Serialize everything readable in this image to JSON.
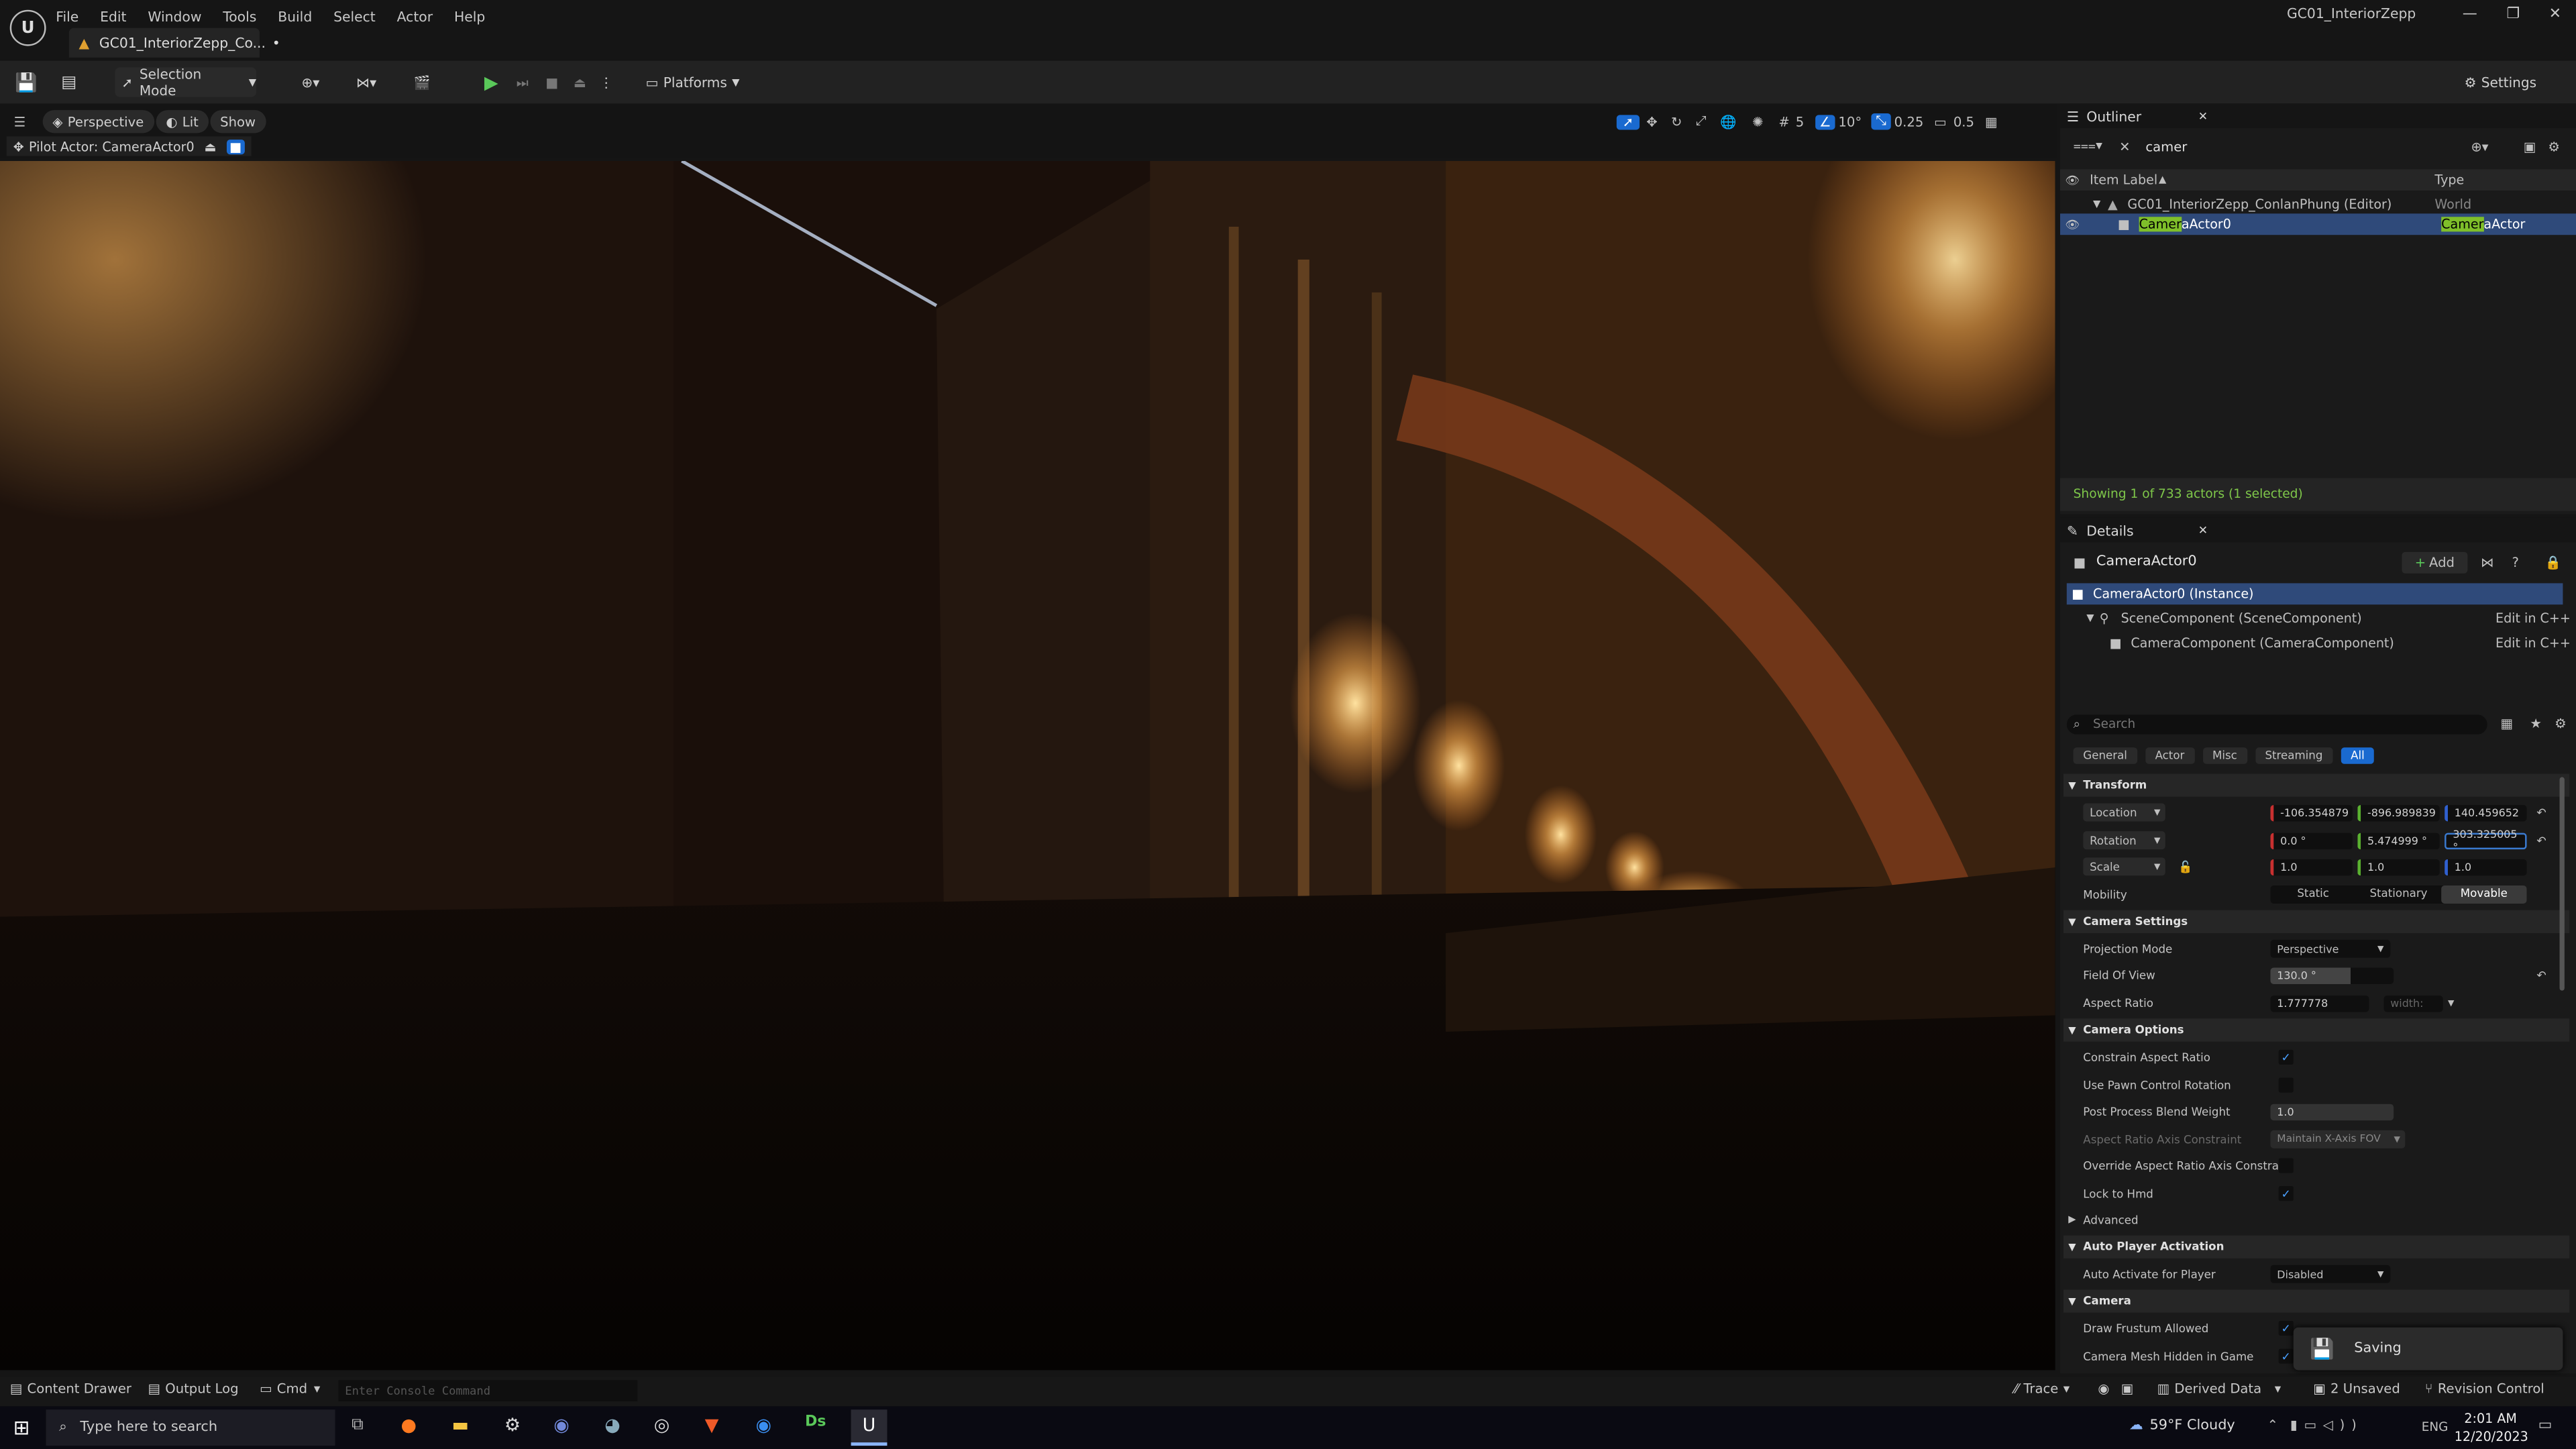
{
  "menu": [
    "File",
    "Edit",
    "Window",
    "Tools",
    "Build",
    "Select",
    "Actor",
    "Help"
  ],
  "doc_tab": "GC01_InteriorZepp_Co...",
  "window_title": "GC01_InteriorZepp",
  "toolbar": {
    "selection_mode": "Selection Mode",
    "platforms": "Platforms",
    "settings": "Settings"
  },
  "viewport": {
    "perspective": "Perspective",
    "lit": "Lit",
    "show": "Show",
    "pilot": "Pilot Actor: CameraActor0",
    "grid": "5",
    "angle": "10°",
    "scale_snap": "0.25",
    "cam_speed": "0.5"
  },
  "outliner": {
    "title": "Outliner",
    "search": "camer",
    "col_label": "Item Label",
    "col_type": "Type",
    "world_row": {
      "label": "GC01_InteriorZepp_ConlanPhung (Editor)",
      "type": "World"
    },
    "actor_row": {
      "label_hl": "Camer",
      "label_rest": "aActor0",
      "type_hl": "Camer",
      "type_rest": "aActor"
    },
    "footer": "Showing 1 of 733 actors (1 selected)"
  },
  "details": {
    "title": "Details",
    "actor_name": "CameraActor0",
    "add": "Add",
    "components": [
      {
        "label": "CameraActor0 (Instance)",
        "edit": ""
      },
      {
        "label": "SceneComponent (SceneComponent)",
        "edit": "Edit in C++"
      },
      {
        "label": "CameraComponent (CameraComponent)",
        "edit": "Edit in C++"
      }
    ],
    "search_placeholder": "Search",
    "filters": [
      "General",
      "Actor",
      "Misc",
      "Streaming",
      "All"
    ],
    "transform": "Transform",
    "location_label": "Location",
    "location": [
      "-106.354879",
      "-896.989839",
      "140.459652"
    ],
    "rotation_label": "Rotation",
    "rotation": [
      "0.0 °",
      "5.474999 °",
      "303.325005 °"
    ],
    "scale_label": "Scale",
    "scale": [
      "1.0",
      "1.0",
      "1.0"
    ],
    "mobility_label": "Mobility",
    "mobility": [
      "Static",
      "Stationary",
      "Movable"
    ],
    "camera_settings": "Camera Settings",
    "projection_mode_label": "Projection Mode",
    "projection_mode": "Perspective",
    "fov_label": "Field Of View",
    "fov": "130.0 °",
    "aspect_label": "Aspect Ratio",
    "aspect": "1.777778",
    "aspect_wh": "width:",
    "camera_options": "Camera Options",
    "opt_constrain": "Constrain Aspect Ratio",
    "opt_pawn": "Use Pawn Control Rotation",
    "opt_blend": "Post Process Blend Weight",
    "blend_value": "1.0",
    "opt_axis": "Aspect Ratio Axis Constraint",
    "axis_value": "Maintain X-Axis FOV",
    "opt_override": "Override Aspect Ratio Axis Constra...",
    "opt_hmd": "Lock to Hmd",
    "advanced": "Advanced",
    "auto_player": "Auto Player Activation",
    "auto_activate_label": "Auto Activate for Player",
    "auto_activate": "Disabled",
    "camera": "Camera",
    "draw_frustum": "Draw Frustum Allowed",
    "mesh_hidden": "Camera Mesh Hidden in Game",
    "saving": "Saving"
  },
  "status": {
    "content_drawer": "Content Drawer",
    "output_log": "Output Log",
    "cmd": "Cmd",
    "console_placeholder": "Enter Console Command",
    "trace": "Trace",
    "derived": "Derived Data",
    "unsaved": "2 Unsaved",
    "revision": "Revision Control"
  },
  "taskbar": {
    "search": "Type here to search",
    "weather": "59°F Cloudy",
    "lang": "ENG",
    "time": "2:01 AM",
    "date": "12/20/2023"
  },
  "colors": {
    "accent": "#0070e0",
    "selected": "#2f4a7a",
    "highlight": "#7fbf2a"
  }
}
